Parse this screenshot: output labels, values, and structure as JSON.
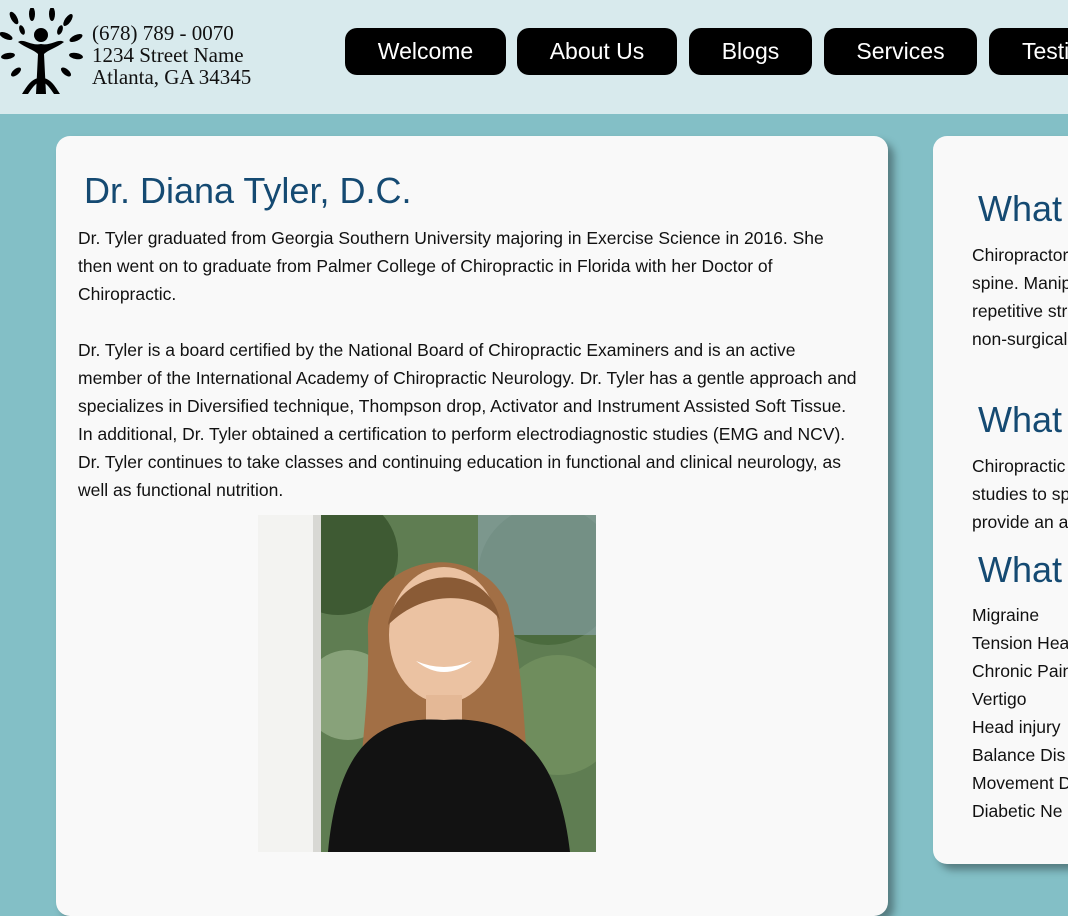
{
  "header": {
    "phone": "(678) 789 - 0070",
    "street": "1234 Street Name",
    "city": "Atlanta, GA 34345",
    "nav": [
      "Welcome",
      "About Us",
      "Blogs",
      "Services",
      "Testi"
    ]
  },
  "profile": {
    "title": "Dr. Diana Tyler, D.C.",
    "paragraph1": "Dr. Tyler graduated from Georgia Southern University majoring in Exercise Science in 2016. She then went on to graduate from Palmer College of Chiropractic in Florida with her Doctor of Chiropractic.",
    "paragraph2": "Dr. Tyler is a board certified by the National Board of Chiropractic Examiners and is an active member of the International Academy of Chiropractic Neurology. Dr. Tyler has a gentle approach and specializes in Diversified technique, Thompson drop, Activator and Instrument Assisted Soft Tissue. In additional, Dr. Tyler obtained a certification to perform electrodiagnostic studies (EMG and NCV). Dr. Tyler continues to take classes and continuing education in functional and clinical neurology, as well as functional nutrition."
  },
  "sidebar": {
    "section1": {
      "heading": "What",
      "lines": [
        "Chiropractor",
        "spine. Manip",
        "repetitive str",
        "non-surgical"
      ]
    },
    "section2": {
      "heading": "What",
      "lines": [
        "Chiropractic",
        "studies to sp",
        "provide an a"
      ]
    },
    "section3": {
      "heading": "What",
      "items": [
        "Migraine",
        "Tension Hea",
        "Chronic Pain",
        "Vertigo",
        "Head injury",
        "Balance Dis",
        "Movement D",
        "Diabetic Ne"
      ]
    }
  },
  "icons": {
    "logo": "tree-person-logo-icon"
  },
  "colors": {
    "page_bg": "#83bfc6",
    "header_bg": "#d8eaed",
    "heading": "#154a72",
    "button": "#000000"
  }
}
